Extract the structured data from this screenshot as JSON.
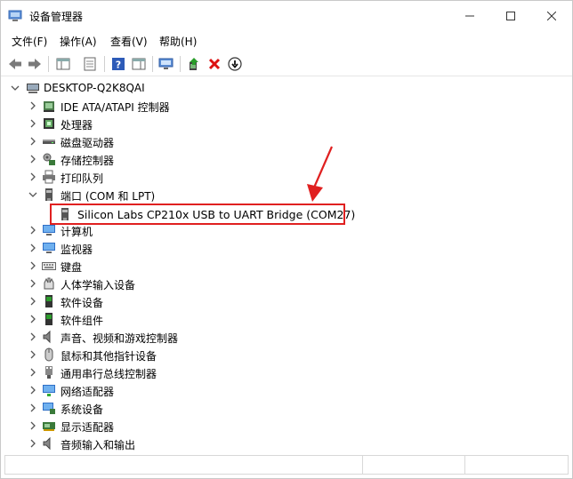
{
  "window": {
    "title": "设备管理器"
  },
  "menu": [
    {
      "label": "文件(F)"
    },
    {
      "label": "操作(A)"
    },
    {
      "label": "查看(V)"
    },
    {
      "label": "帮助(H)"
    }
  ],
  "toolbar": {
    "buttons": [
      {
        "icon": "back-arrow-icon"
      },
      {
        "icon": "forward-arrow-icon"
      },
      {
        "icon": "show-hide-console-tree-icon"
      },
      {
        "icon": "properties-icon"
      },
      {
        "icon": "help-icon"
      },
      {
        "icon": "action-pane-icon"
      },
      {
        "icon": "scan-hardware-icon"
      },
      {
        "icon": "update-driver-icon"
      },
      {
        "icon": "uninstall-device-icon"
      },
      {
        "icon": "download-driver-icon"
      }
    ]
  },
  "tree": {
    "root": "DESKTOP-Q2K8QAI",
    "items": [
      {
        "label": "IDE ATA/ATAPI 控制器",
        "icon": "ide-controller-icon",
        "expanded": false
      },
      {
        "label": "处理器",
        "icon": "processor-icon",
        "expanded": false
      },
      {
        "label": "磁盘驱动器",
        "icon": "disk-drive-icon",
        "expanded": false
      },
      {
        "label": "存储控制器",
        "icon": "storage-controller-icon",
        "expanded": false
      },
      {
        "label": "打印队列",
        "icon": "printer-icon",
        "expanded": false
      },
      {
        "label": "端口 (COM 和 LPT)",
        "icon": "port-icon",
        "expanded": true
      },
      {
        "label": "计算机",
        "icon": "computer-icon",
        "expanded": false
      },
      {
        "label": "监视器",
        "icon": "monitor-icon",
        "expanded": false
      },
      {
        "label": "键盘",
        "icon": "keyboard-icon",
        "expanded": false
      },
      {
        "label": "人体学输入设备",
        "icon": "hid-icon",
        "expanded": false
      },
      {
        "label": "软件设备",
        "icon": "software-device-icon",
        "expanded": false
      },
      {
        "label": "软件组件",
        "icon": "software-component-icon",
        "expanded": false
      },
      {
        "label": "声音、视频和游戏控制器",
        "icon": "sound-icon",
        "expanded": false
      },
      {
        "label": "鼠标和其他指针设备",
        "icon": "mouse-icon",
        "expanded": false
      },
      {
        "label": "通用串行总线控制器",
        "icon": "usb-icon",
        "expanded": false
      },
      {
        "label": "网络适配器",
        "icon": "network-adapter-icon",
        "expanded": false
      },
      {
        "label": "系统设备",
        "icon": "system-device-icon",
        "expanded": false
      },
      {
        "label": "显示适配器",
        "icon": "display-adapter-icon",
        "expanded": false
      },
      {
        "label": "音频输入和输出",
        "icon": "audio-io-icon",
        "expanded": false
      }
    ],
    "port_child": "Silicon Labs CP210x USB to UART Bridge (COM27)"
  },
  "annotations": {
    "highlight_color": "#e02020"
  }
}
